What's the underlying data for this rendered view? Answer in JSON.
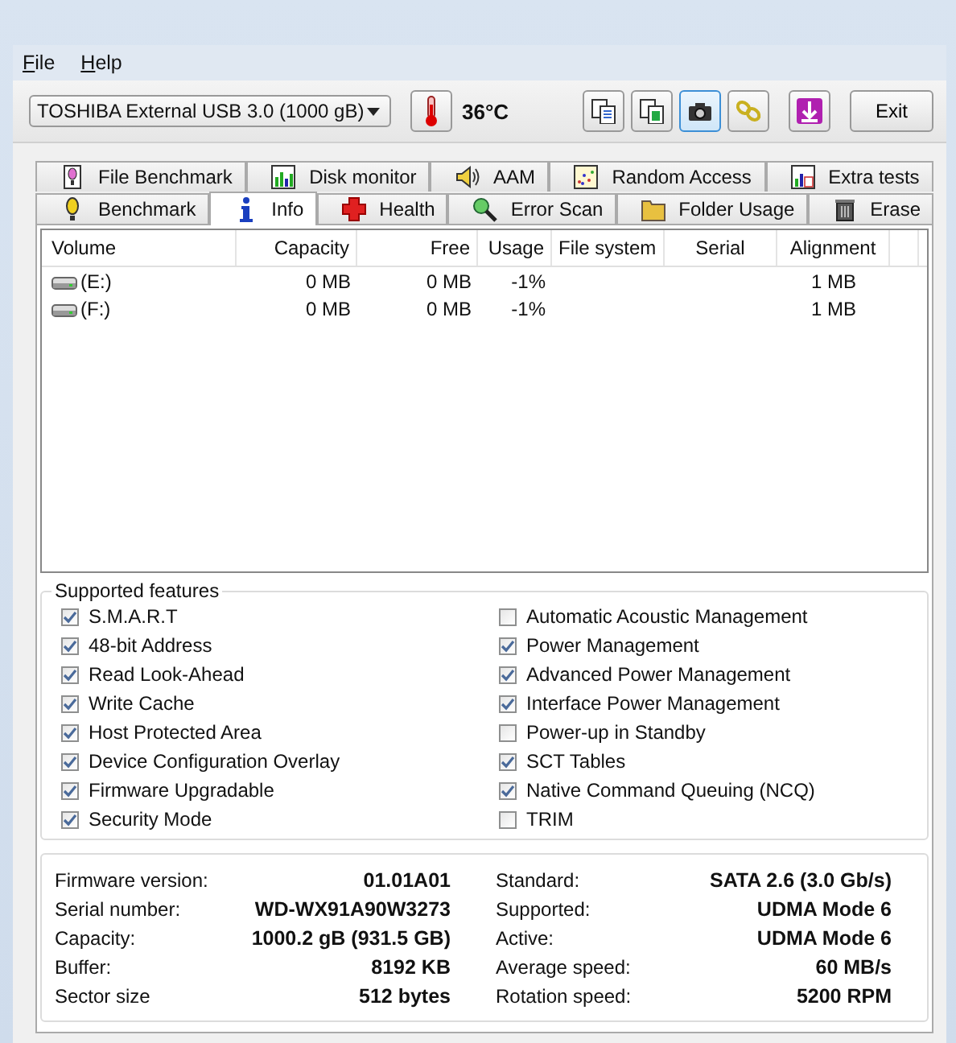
{
  "menu": [
    {
      "label": "File"
    },
    {
      "label": "Help"
    }
  ],
  "toolbar": {
    "drive": "TOSHIBA External USB 3.0 (1000 gB)",
    "temperature": "36°C",
    "tool_buttons": [
      {
        "selected": false
      },
      {
        "selected": false
      },
      {
        "selected": true
      },
      {
        "selected": false
      },
      {
        "selected": false
      }
    ],
    "exit": "Exit"
  },
  "tabs": [
    [
      {
        "label": "File Benchmark",
        "selected": false
      },
      {
        "label": "Disk monitor",
        "selected": false
      },
      {
        "label": "AAM",
        "selected": false
      },
      {
        "label": "Random Access",
        "selected": false
      },
      {
        "label": "Extra tests",
        "selected": false
      }
    ],
    [
      {
        "label": "Benchmark",
        "selected": false
      },
      {
        "label": "Info",
        "selected": true
      },
      {
        "label": "Health",
        "selected": false
      },
      {
        "label": "Error Scan",
        "selected": false
      },
      {
        "label": "Folder Usage",
        "selected": false
      },
      {
        "label": "Erase",
        "selected": false
      }
    ]
  ],
  "volumes": {
    "columns": [
      "Volume",
      "Capacity",
      "Free",
      "Usage",
      "File system",
      "Serial",
      "Alignment"
    ],
    "rows": [
      [
        "(E:)",
        "0 MB",
        "0 MB",
        "-1%",
        "",
        "",
        "1 MB"
      ],
      [
        "(F:)",
        "0 MB",
        "0 MB",
        "-1%",
        "",
        "",
        "1 MB"
      ]
    ]
  },
  "features": {
    "title": "Supported features",
    "left": [
      {
        "label": "S.M.A.R.T",
        "checked": true
      },
      {
        "label": "48-bit Address",
        "checked": true
      },
      {
        "label": "Read Look-Ahead",
        "checked": true
      },
      {
        "label": "Write Cache",
        "checked": true
      },
      {
        "label": "Host Protected Area",
        "checked": true
      },
      {
        "label": "Device Configuration Overlay",
        "checked": true
      },
      {
        "label": "Firmware Upgradable",
        "checked": true
      },
      {
        "label": "Security Mode",
        "checked": true
      }
    ],
    "right": [
      {
        "label": "Automatic Acoustic Management",
        "checked": false
      },
      {
        "label": "Power Management",
        "checked": true
      },
      {
        "label": "Advanced Power Management",
        "checked": true
      },
      {
        "label": "Interface Power Management",
        "checked": true
      },
      {
        "label": "Power-up in Standby",
        "checked": false
      },
      {
        "label": "SCT Tables",
        "checked": true
      },
      {
        "label": "Native Command Queuing (NCQ)",
        "checked": true
      },
      {
        "label": "TRIM",
        "checked": false
      }
    ]
  },
  "details": {
    "left": [
      {
        "label": "Firmware version:",
        "value": "01.01A01"
      },
      {
        "label": "Serial number:",
        "value": "WD-WX91A90W3273"
      },
      {
        "label": "Capacity:",
        "value": "1000.2 gB (931.5 GB)"
      },
      {
        "label": "Buffer:",
        "value": "8192 KB"
      },
      {
        "label": "Sector size",
        "value": "512 bytes"
      }
    ],
    "right": [
      {
        "label": "Standard:",
        "value": "SATA 2.6 (3.0 Gb/s)"
      },
      {
        "label": "Supported:",
        "value": "UDMA Mode 6"
      },
      {
        "label": "Active:",
        "value": "UDMA Mode 6"
      },
      {
        "label": "Average speed:",
        "value": "60 MB/s"
      },
      {
        "label": "Rotation speed:",
        "value": "5200 RPM"
      }
    ]
  }
}
